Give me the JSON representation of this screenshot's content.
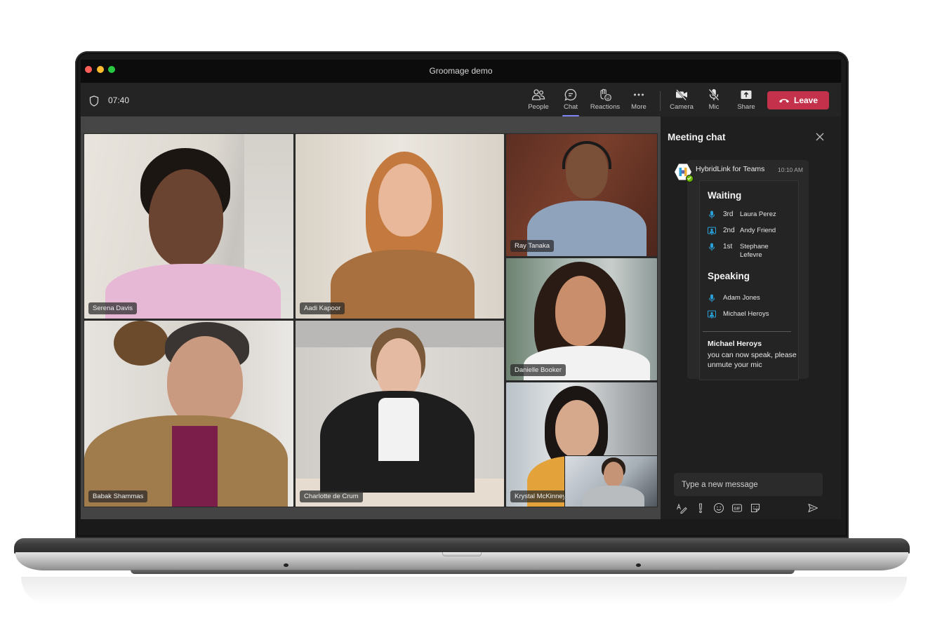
{
  "window": {
    "title": "Groomage demo"
  },
  "toolbar": {
    "timer": "07:40",
    "buttons": [
      {
        "id": "people",
        "label": "People",
        "icon": "people-icon"
      },
      {
        "id": "chat",
        "label": "Chat",
        "icon": "chat-icon",
        "active": true
      },
      {
        "id": "reactions",
        "label": "Reactions",
        "icon": "reactions-icon"
      },
      {
        "id": "more",
        "label": "More",
        "icon": "more-icon"
      },
      {
        "id": "camera",
        "label": "Camera",
        "icon": "camera-off-icon"
      },
      {
        "id": "mic",
        "label": "Mic",
        "icon": "mic-off-icon"
      },
      {
        "id": "share",
        "label": "Share",
        "icon": "share-icon"
      }
    ],
    "leave_label": "Leave"
  },
  "participants": [
    {
      "name": "Serena Davis"
    },
    {
      "name": "Aadi Kapoor"
    },
    {
      "name": "Ray Tanaka"
    },
    {
      "name": "Danielle Booker"
    },
    {
      "name": "Babak Shammas"
    },
    {
      "name": "Charlotte de Crum"
    },
    {
      "name": "Krystal McKinney"
    }
  ],
  "chat": {
    "title": "Meeting chat",
    "message": {
      "sender": "HybridLink for Teams",
      "time": "10:10 AM",
      "card": {
        "waiting_heading": "Waiting",
        "waiting": [
          {
            "rank": "3rd",
            "name": "Laura Perez",
            "icon": "mic-icon"
          },
          {
            "rank": "2nd",
            "name": "Andy Friend",
            "icon": "room-icon"
          },
          {
            "rank": "1st",
            "name": "Stephane Lefevre",
            "icon": "mic-icon"
          }
        ],
        "speaking_heading": "Speaking",
        "speaking": [
          {
            "name": "Adam Jones",
            "icon": "mic-icon"
          },
          {
            "name": "Michael Heroys",
            "icon": "room-icon"
          }
        ],
        "notice_name": "Michael Heroys",
        "notice_text": "you can now speak, please unmute your mic"
      }
    },
    "compose_placeholder": "Type a new message"
  },
  "colors": {
    "accent": "#7f85f5",
    "leave": "#c4314b",
    "queue_icon": "#2aa0d8",
    "presence": "#6bb700"
  }
}
